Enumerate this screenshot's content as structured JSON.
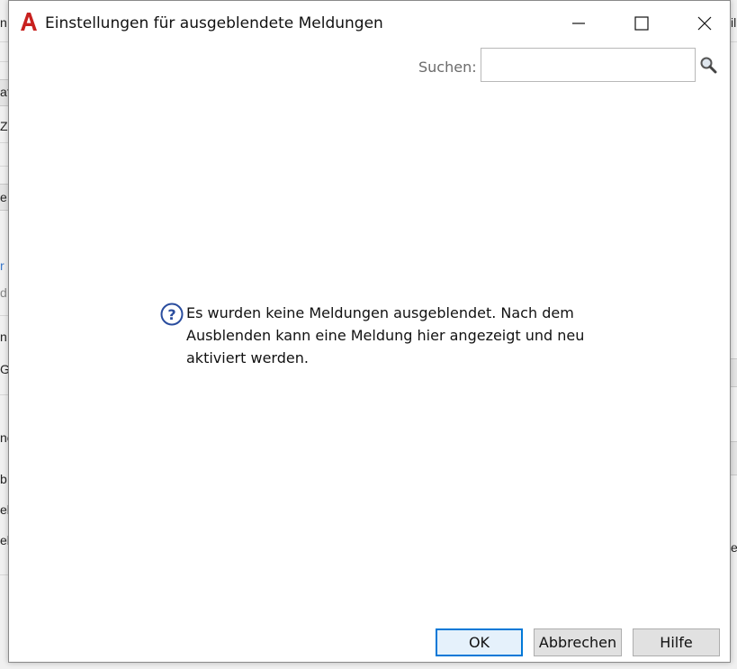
{
  "window": {
    "title": "Einstellungen für ausgeblendete Meldungen",
    "icon": "autocad-a-icon",
    "controls": [
      "minimize-icon",
      "maximize-icon",
      "close-icon"
    ]
  },
  "search": {
    "label": "Suchen:",
    "value": "",
    "placeholder": "",
    "icon": "magnifier-icon"
  },
  "message": {
    "icon": "help-question-icon",
    "text": "Es wurden keine Meldungen ausgeblendet. Nach dem Ausblenden kann eine Meldung hier angezeigt und neu aktiviert werden."
  },
  "buttons": {
    "ok": "OK",
    "cancel": "Abbrechen",
    "help": "Hilfe"
  },
  "background": {
    "left": [
      "n",
      "af",
      "Ze",
      "e",
      "r",
      "d",
      "n",
      "G",
      "ne",
      "b",
      "ell",
      "ell"
    ],
    "right": [
      "il",
      "er"
    ]
  },
  "colors": {
    "accent": "#0078d7",
    "icon_red": "#c8201e",
    "help_blue": "#2a4d9e"
  }
}
